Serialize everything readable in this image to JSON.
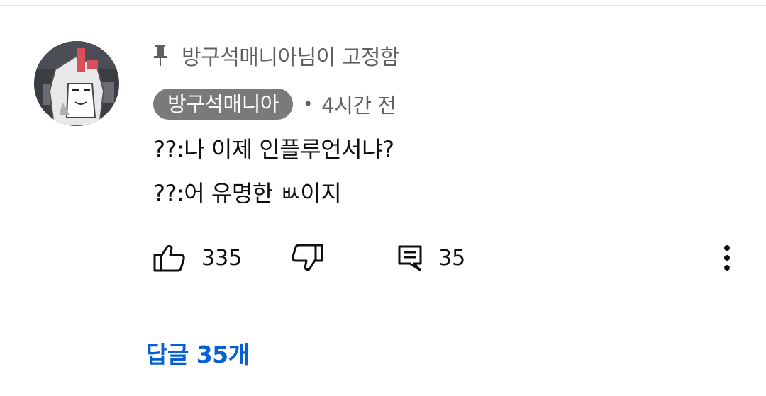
{
  "pinned": {
    "text": "방구석매니아님이 고정함",
    "icon": "pin-icon"
  },
  "author": {
    "name": "방구석매니아",
    "avatar_icon": "avatar"
  },
  "meta": {
    "separator": "•",
    "time": "4시간 전"
  },
  "comment": {
    "lines": [
      "??:나 이제 인플루언서냐?",
      "??:어 유명한 ㅄ이지"
    ]
  },
  "actions": {
    "like_count": "335",
    "reply_count": "35",
    "icons": [
      "thumbs-up-icon",
      "thumbs-down-icon",
      "comment-icon",
      "more-vert-icon"
    ]
  },
  "replies": {
    "label": "답글 35개"
  },
  "colors": {
    "link": "#065fd4",
    "secondary_text": "#606060",
    "chip_bg": "#7a7a7a"
  }
}
